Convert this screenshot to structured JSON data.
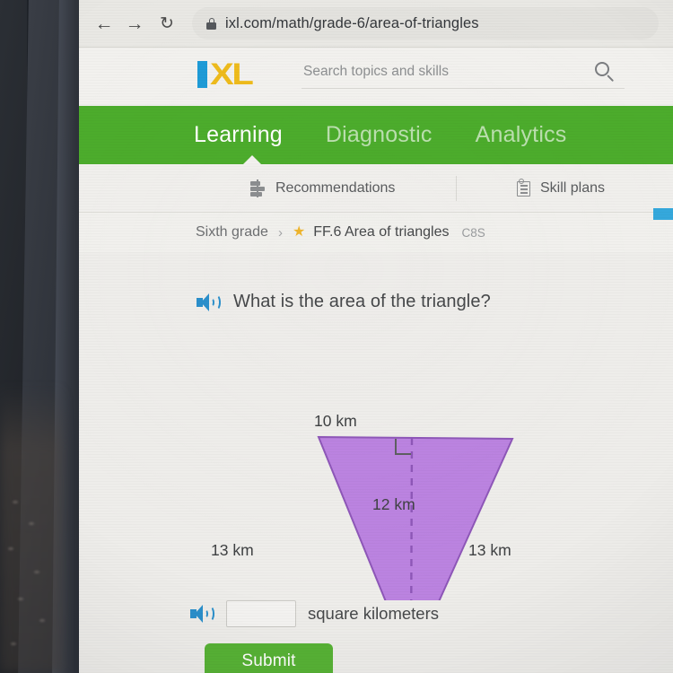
{
  "browser": {
    "back_icon": "arrow-left-icon",
    "forward_icon": "arrow-right-icon",
    "reload_icon": "reload-icon",
    "lock_icon": "lock-icon",
    "url": "ixl.com/math/grade-6/area-of-triangles"
  },
  "masthead": {
    "logo_i": "I",
    "logo_xl": "XL",
    "logo_blue": "#1e9bd7",
    "logo_gold": "#eebb1c",
    "search_placeholder": "Search topics and skills",
    "search_value": "",
    "search_icon": "search-icon"
  },
  "greennav": {
    "accent": "#4cac2c",
    "items": [
      {
        "label": "Learning",
        "active": true
      },
      {
        "label": "Diagnostic",
        "active": false
      },
      {
        "label": "Analytics",
        "active": false
      }
    ]
  },
  "subnav": {
    "recommendations": "Recommendations",
    "recommendations_icon": "recommendations-icon",
    "skill_plans": "Skill plans",
    "skill_plans_icon": "skill-plans-icon"
  },
  "breadcrumb": {
    "grade": "Sixth grade",
    "separator": "›",
    "star_icon": "star-icon",
    "star_color": "#efb52c",
    "skill": "FF.6 Area of triangles",
    "code": "C8S"
  },
  "question": {
    "audio_icon": "speaker-icon",
    "text": "What is the area of the triangle?"
  },
  "figure": {
    "shape": "triangle",
    "orientation": "inverted",
    "fill": "#bb83e0",
    "stroke": "#8e57b8",
    "top_label": "10 km",
    "height_label": "12 km",
    "left_label": "13 km",
    "right_label": "13 km",
    "right_angle_marker": true,
    "height_line": "dashed"
  },
  "answer": {
    "audio_icon": "speaker-icon",
    "input_value": "",
    "input_placeholder": "",
    "unit": "square kilometers"
  },
  "submit": {
    "label": "Submit",
    "color": "#57b235"
  }
}
